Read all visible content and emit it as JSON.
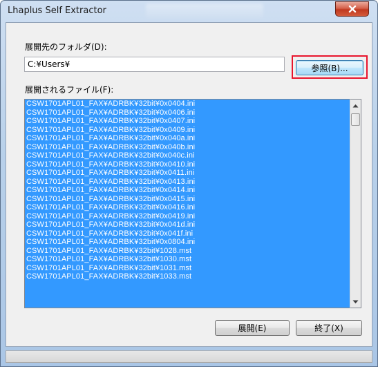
{
  "window": {
    "title": "Lhaplus Self Extractor"
  },
  "folder": {
    "label": "展開先のフォルダ(D):",
    "path_value": "C:¥Users¥",
    "browse_label": "参照(B)..."
  },
  "files": {
    "label": "展開されるファイル(F):",
    "items": [
      "CSW1701APL01_FAX¥ADRBK¥32bit¥0x0404.ini",
      "CSW1701APL01_FAX¥ADRBK¥32bit¥0x0406.ini",
      "CSW1701APL01_FAX¥ADRBK¥32bit¥0x0407.ini",
      "CSW1701APL01_FAX¥ADRBK¥32bit¥0x0409.ini",
      "CSW1701APL01_FAX¥ADRBK¥32bit¥0x040a.ini",
      "CSW1701APL01_FAX¥ADRBK¥32bit¥0x040b.ini",
      "CSW1701APL01_FAX¥ADRBK¥32bit¥0x040c.ini",
      "CSW1701APL01_FAX¥ADRBK¥32bit¥0x0410.ini",
      "CSW1701APL01_FAX¥ADRBK¥32bit¥0x0411.ini",
      "CSW1701APL01_FAX¥ADRBK¥32bit¥0x0413.ini",
      "CSW1701APL01_FAX¥ADRBK¥32bit¥0x0414.ini",
      "CSW1701APL01_FAX¥ADRBK¥32bit¥0x0415.ini",
      "CSW1701APL01_FAX¥ADRBK¥32bit¥0x0416.ini",
      "CSW1701APL01_FAX¥ADRBK¥32bit¥0x0419.ini",
      "CSW1701APL01_FAX¥ADRBK¥32bit¥0x041d.ini",
      "CSW1701APL01_FAX¥ADRBK¥32bit¥0x041f.ini",
      "CSW1701APL01_FAX¥ADRBK¥32bit¥0x0804.ini",
      "CSW1701APL01_FAX¥ADRBK¥32bit¥1028.mst",
      "CSW1701APL01_FAX¥ADRBK¥32bit¥1030.mst",
      "CSW1701APL01_FAX¥ADRBK¥32bit¥1031.mst",
      "CSW1701APL01_FAX¥ADRBK¥32bit¥1033.mst"
    ]
  },
  "actions": {
    "extract_label": "展開(E)",
    "exit_label": "終了(X)"
  },
  "colors": {
    "selection": "#3399ff",
    "highlight_border": "#e8142c",
    "close_button": "#c0391f"
  },
  "icons": {
    "close": "close-icon",
    "scroll_up": "scroll-up-arrow-icon",
    "scroll_down": "scroll-down-arrow-icon"
  }
}
